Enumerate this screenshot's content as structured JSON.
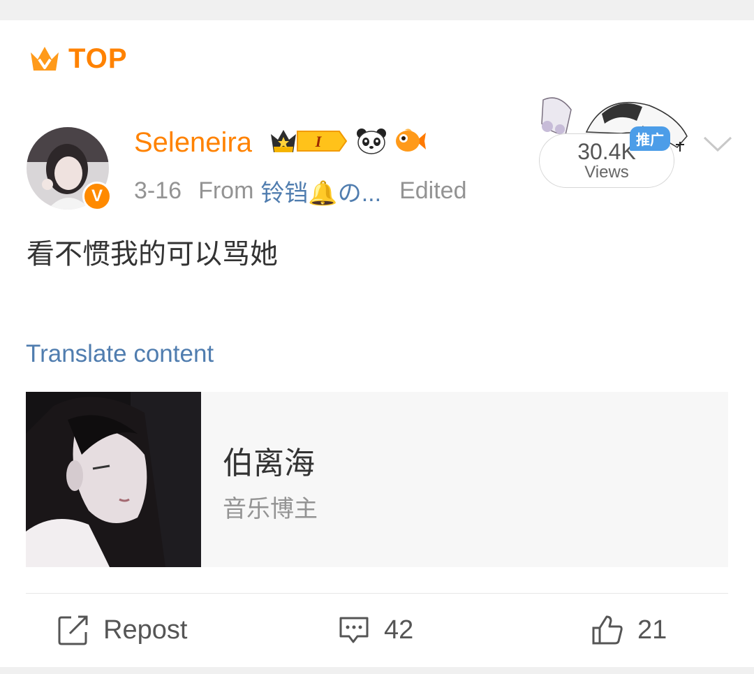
{
  "header": {
    "pin_label": "TOP"
  },
  "author": {
    "name": "Seleneira",
    "verified_mark": "V",
    "badges": [
      "crown-level-badge",
      "panda-icon",
      "goldfish-icon"
    ],
    "level_label": "I"
  },
  "meta": {
    "date": "3-16",
    "from_label": "From",
    "source": "铃铛🔔の...",
    "edited_label": "Edited"
  },
  "views": {
    "count": "30.4K",
    "label": "Views",
    "promo_tag": "推广"
  },
  "post": {
    "text": "看不惯我的可以骂她",
    "translate_label": "Translate content"
  },
  "link_card": {
    "title": "伯离海",
    "subtitle": "音乐博主"
  },
  "actions": {
    "repost_label": "Repost",
    "comment_count": "42",
    "like_count": "21"
  },
  "colors": {
    "accent": "#ff8200",
    "link": "#507daf",
    "promo": "#4c9de8"
  }
}
